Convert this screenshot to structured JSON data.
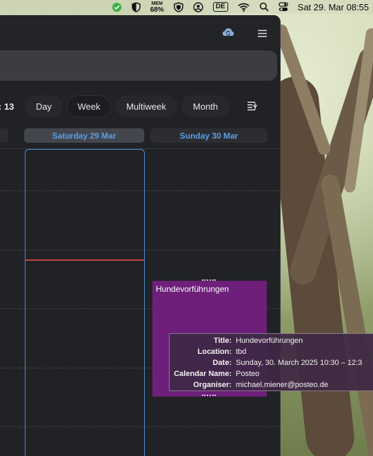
{
  "menubar": {
    "mem_label": "MEM",
    "mem_value": "68%",
    "input_source": "DE",
    "datetime": "Sat 29. Mar  08:55"
  },
  "toolbar": {
    "week_number_partial": ": 13",
    "views": [
      "Day",
      "Week",
      "Multiweek",
      "Month"
    ],
    "active_view": "Week"
  },
  "columns": [
    {
      "label": "Saturday 29 Mar",
      "today": true
    },
    {
      "label": "Sunday 30 Mar",
      "today": false
    }
  ],
  "event": {
    "title": "Hundevorführungen",
    "color": "#6d1f7a"
  },
  "tooltip": {
    "rows": [
      {
        "key": "Title:",
        "value": "Hundevorführungen"
      },
      {
        "key": "Location:",
        "value": "tbd"
      },
      {
        "key": "Date:",
        "value": "Sunday, 30. March 2025 10:30 – 12:3"
      },
      {
        "key": "Calendar Name:",
        "value": "Posteo"
      },
      {
        "key": "Organiser:",
        "value": "michael.miener@posteo.de"
      }
    ]
  },
  "colors": {
    "accent": "#5b9de6",
    "today_border": "#4d8fd6",
    "now_line": "#c2434a"
  },
  "icons": [
    "check-circle-icon",
    "shield-half-icon",
    "shield-badge-icon",
    "user-circle-icon",
    "wifi-icon",
    "search-icon",
    "control-center-icon",
    "cloud-sync-icon",
    "hamburger-menu-icon",
    "filter-list-icon"
  ]
}
